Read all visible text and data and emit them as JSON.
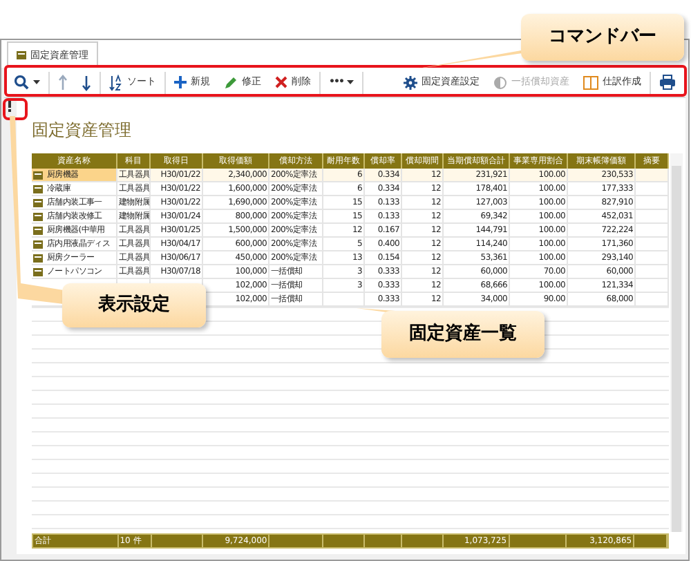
{
  "tab": {
    "label": "固定資産管理"
  },
  "toolbar": {
    "left": [
      {
        "kind": "search"
      },
      {
        "kind": "up"
      },
      {
        "kind": "down"
      },
      {
        "kind": "sort",
        "label": "ソート"
      },
      {
        "kind": "new",
        "label": "新規"
      },
      {
        "kind": "edit",
        "label": "修正"
      },
      {
        "kind": "delete",
        "label": "削除"
      },
      {
        "kind": "more",
        "label": "•••"
      }
    ],
    "right": [
      {
        "kind": "settings",
        "label": "固定資産設定",
        "disabled": false
      },
      {
        "kind": "bulk",
        "label": "一括償却資産",
        "disabled": true
      },
      {
        "kind": "journal",
        "label": "仕訳作成",
        "disabled": false
      },
      {
        "kind": "print"
      }
    ]
  },
  "title": "固定資産管理",
  "table": {
    "columns": [
      "資産名称",
      "科目",
      "取得日",
      "取得価額",
      "償却方法",
      "耐用年数",
      "償却率",
      "償却期間",
      "当期償却額合計",
      "事業専用割合",
      "期末帳簿価額",
      "摘要"
    ],
    "rows": [
      {
        "selected": true,
        "cells": [
          "厨房機器",
          "工具器具",
          "H30/01/22",
          "2,340,000",
          "200%定率法",
          "6",
          "0.334",
          "12",
          "231,921",
          "100.00",
          "230,533"
        ]
      },
      {
        "selected": false,
        "cells": [
          "冷蔵庫",
          "工具器具",
          "H30/01/22",
          "1,600,000",
          "200%定率法",
          "6",
          "0.334",
          "12",
          "178,401",
          "100.00",
          "177,333"
        ]
      },
      {
        "selected": false,
        "cells": [
          "店舗内装工事一",
          "建物附属",
          "H30/01/22",
          "1,690,000",
          "200%定率法",
          "15",
          "0.133",
          "12",
          "127,003",
          "100.00",
          "827,910"
        ]
      },
      {
        "selected": false,
        "cells": [
          "店舗内装改修工",
          "建物附属",
          "H30/01/24",
          "800,000",
          "200%定率法",
          "15",
          "0.133",
          "12",
          "69,342",
          "100.00",
          "452,031"
        ]
      },
      {
        "selected": false,
        "cells": [
          "厨房機器(中華用",
          "工具器具",
          "H30/01/25",
          "1,500,000",
          "200%定率法",
          "12",
          "0.167",
          "12",
          "144,791",
          "100.00",
          "722,224"
        ]
      },
      {
        "selected": false,
        "cells": [
          "店内用液晶ディス",
          "工具器具",
          "H30/04/17",
          "600,000",
          "200%定率法",
          "5",
          "0.400",
          "12",
          "114,240",
          "100.00",
          "171,360"
        ]
      },
      {
        "selected": false,
        "cells": [
          "厨房クーラー",
          "工具器具",
          "H30/06/17",
          "450,000",
          "200%定率法",
          "13",
          "0.154",
          "12",
          "53,361",
          "100.00",
          "293,140"
        ]
      },
      {
        "selected": false,
        "cells": [
          "ノートパソコン",
          "工具器具",
          "H30/07/18",
          "100,000",
          "一括償却",
          "3",
          "0.333",
          "12",
          "60,000",
          "70.00",
          "60,000"
        ]
      },
      {
        "selected": false,
        "cells": [
          null,
          null,
          null,
          "102,000",
          "一括償却",
          "3",
          "0.333",
          "12",
          "68,666",
          "100.00",
          "121,334"
        ]
      },
      {
        "selected": false,
        "cells": [
          null,
          null,
          null,
          "102,000",
          "一括償却",
          null,
          "0.333",
          "12",
          "34,000",
          "90.00",
          "68,000"
        ]
      }
    ],
    "footer": {
      "label": "合計",
      "count": "10 件",
      "acquisition_cost": "9,724,000",
      "depreciation_total": "1,073,725",
      "book_value": "3,120,865"
    }
  },
  "callouts": [
    {
      "kind": "commandbar",
      "text": "コマンドバー"
    },
    {
      "kind": "display",
      "text": "表示設定"
    },
    {
      "kind": "list",
      "text": "固定資産一覧"
    }
  ]
}
